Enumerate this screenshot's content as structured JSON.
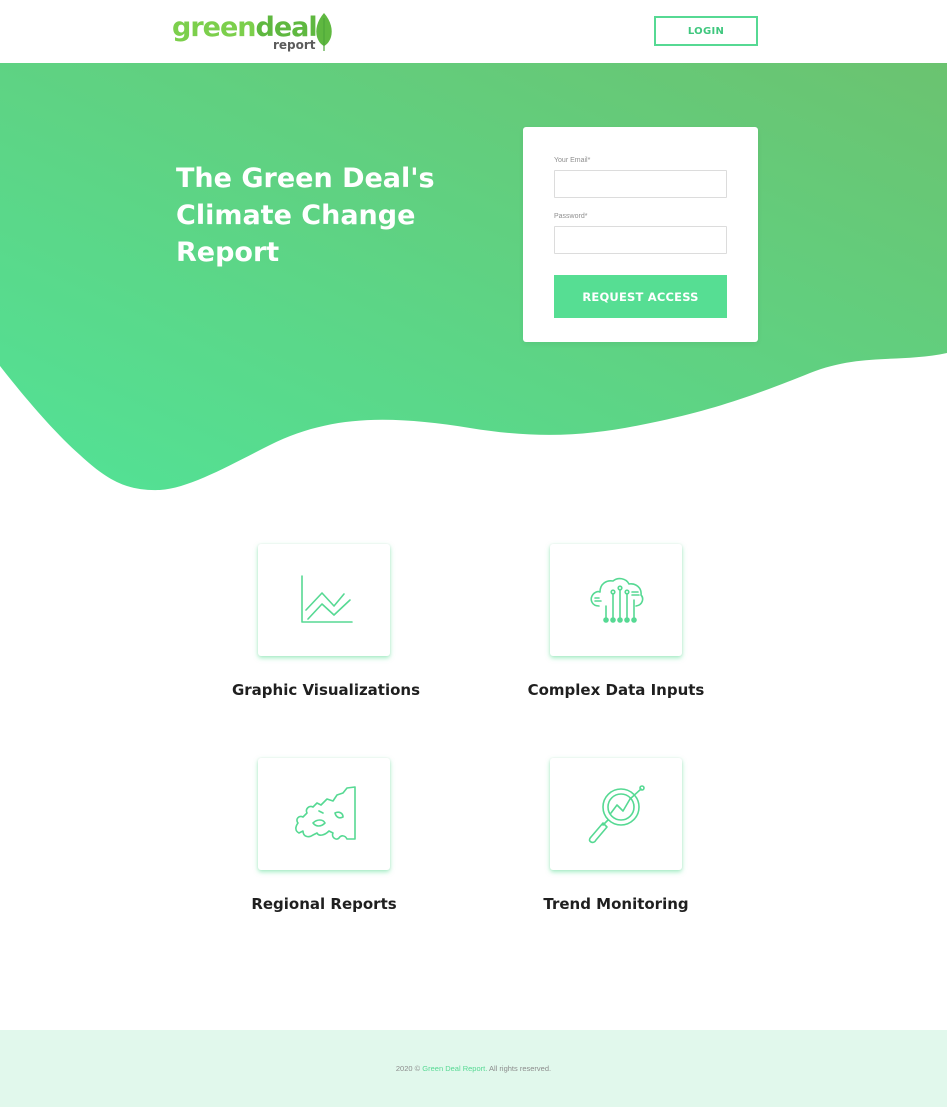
{
  "brand": {
    "logo_part1": "green",
    "logo_part2": "deal",
    "logo_sub": "report",
    "colors": {
      "primary": "#56de93",
      "secondary": "#6bc370",
      "dark_text": "#1f1f1f"
    }
  },
  "header": {
    "login_label": "LOGIN"
  },
  "hero": {
    "title": "The Green Deal's Climate Change Report"
  },
  "form": {
    "email_label": "Your Email*",
    "email_value": "",
    "password_label": "Password*",
    "password_value": "",
    "submit_label": "REQUEST ACCESS"
  },
  "features": [
    {
      "icon": "line-chart-icon",
      "label": "Graphic Visualizations"
    },
    {
      "icon": "cloud-data-icon",
      "label": "Complex Data Inputs"
    },
    {
      "icon": "europe-map-icon",
      "label": "Regional Reports"
    },
    {
      "icon": "magnifier-trend-icon",
      "label": "Trend Monitoring"
    }
  ],
  "footer": {
    "prefix": "2020 © ",
    "link": "Green Deal Report.",
    "suffix": " All rights reserved."
  }
}
